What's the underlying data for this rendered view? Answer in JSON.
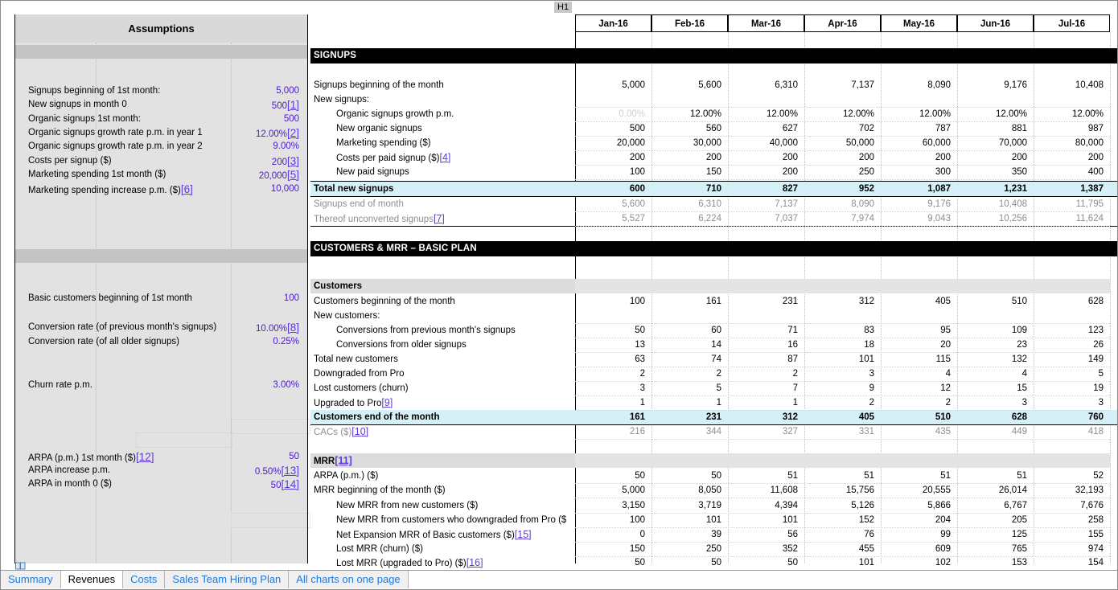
{
  "namebox": {
    "value": "H1"
  },
  "assumptions": {
    "title": "Assumptions",
    "rows": [
      {
        "label": "Signups beginning of 1st month:",
        "value": "5,000",
        "ref": ""
      },
      {
        "label": "New signups in month 0",
        "value": "500",
        "ref": "[1]"
      },
      {
        "label": "Organic signups 1st month:",
        "value": "500",
        "ref": ""
      },
      {
        "label": "Organic signups growth rate p.m. in year 1",
        "value": "12.00%",
        "ref": "[2]"
      },
      {
        "label": "Organic signups growth rate p.m. in year 2",
        "value": "9.00%",
        "ref": ""
      },
      {
        "label": "Costs per signup ($)",
        "value": "200",
        "ref": "[3]"
      },
      {
        "label": "Marketing spending 1st month ($)",
        "value": "20,000",
        "ref": "[5]"
      },
      {
        "label": "Marketing spending increase p.m. ($)",
        "label_ref": "[6]",
        "value": "10,000",
        "ref": ""
      },
      {
        "label": "Basic customers beginning of 1st month",
        "value": "100",
        "ref": ""
      },
      {
        "label": "Conversion rate (of previous month's signups)",
        "value": "10.00%",
        "ref": "[8]"
      },
      {
        "label": "Conversion rate (of all older signups)",
        "value": "0.25%",
        "ref": ""
      },
      {
        "label": "Churn rate p.m.",
        "value": "3.00%",
        "ref": ""
      },
      {
        "label": "ARPA (p.m.) 1st month ($)",
        "label_ref": "[12]",
        "value": "50",
        "ref": ""
      },
      {
        "label": "ARPA increase p.m.",
        "value": "0.50%",
        "ref": "[13]"
      },
      {
        "label": "ARPA in month 0 ($)",
        "value": "50",
        "ref": "[14]"
      }
    ]
  },
  "grid": {
    "columns": [
      "Jan-16",
      "Feb-16",
      "Mar-16",
      "Apr-16",
      "May-16",
      "Jun-16",
      "Jul-16"
    ],
    "sections": [
      {
        "title": "SIGNUPS"
      },
      {
        "title": "CUSTOMERS & MRR – BASIC PLAN"
      }
    ],
    "subheads": [
      "Customers",
      "MRR"
    ],
    "mrr_subhead_ref": "[11]",
    "rows": [
      {
        "label": "Signups beginning of the month",
        "values": [
          "5,000",
          "5,600",
          "6,310",
          "7,137",
          "8,090",
          "9,176",
          "10,408"
        ]
      },
      {
        "label": "New signups:",
        "values": [
          "",
          "",
          "",
          "",
          "",
          "",
          ""
        ]
      },
      {
        "label": "Organic signups growth p.m.",
        "values": [
          "0.00%",
          "12.00%",
          "12.00%",
          "12.00%",
          "12.00%",
          "12.00%",
          "12.00%"
        ]
      },
      {
        "label": "New organic signups",
        "values": [
          "500",
          "560",
          "627",
          "702",
          "787",
          "881",
          "987"
        ]
      },
      {
        "label": "Marketing spending ($)",
        "values": [
          "20,000",
          "30,000",
          "40,000",
          "50,000",
          "60,000",
          "70,000",
          "80,000"
        ]
      },
      {
        "label": "Costs per paid signup ($)",
        "ref": "[4]",
        "values": [
          "200",
          "200",
          "200",
          "200",
          "200",
          "200",
          "200"
        ]
      },
      {
        "label": "New paid signups",
        "values": [
          "100",
          "150",
          "200",
          "250",
          "300",
          "350",
          "400"
        ]
      },
      {
        "label": "Total new signups",
        "values": [
          "600",
          "710",
          "827",
          "952",
          "1,087",
          "1,231",
          "1,387"
        ]
      },
      {
        "label": "Signups end of month",
        "values": [
          "5,600",
          "6,310",
          "7,137",
          "8,090",
          "9,176",
          "10,408",
          "11,795"
        ]
      },
      {
        "label": "Thereof unconverted signups",
        "ref": "[7]",
        "values": [
          "5,527",
          "6,224",
          "7,037",
          "7,974",
          "9,043",
          "10,256",
          "11,624"
        ]
      },
      {
        "label": "Customers beginning of the month",
        "values": [
          "100",
          "161",
          "231",
          "312",
          "405",
          "510",
          "628"
        ]
      },
      {
        "label": "New customers:",
        "values": [
          "",
          "",
          "",
          "",
          "",
          "",
          ""
        ]
      },
      {
        "label": "Conversions from previous month's signups",
        "values": [
          "50",
          "60",
          "71",
          "83",
          "95",
          "109",
          "123"
        ]
      },
      {
        "label": "Conversions from older signups",
        "values": [
          "13",
          "14",
          "16",
          "18",
          "20",
          "23",
          "26"
        ]
      },
      {
        "label": "Total new customers",
        "values": [
          "63",
          "74",
          "87",
          "101",
          "115",
          "132",
          "149"
        ]
      },
      {
        "label": "Downgraded from Pro",
        "values": [
          "2",
          "2",
          "2",
          "3",
          "4",
          "4",
          "5"
        ]
      },
      {
        "label": "Lost customers (churn)",
        "values": [
          "3",
          "5",
          "7",
          "9",
          "12",
          "15",
          "19"
        ]
      },
      {
        "label": "Upgraded to Pro",
        "ref": "[9]",
        "values": [
          "1",
          "1",
          "1",
          "2",
          "2",
          "3",
          "3"
        ]
      },
      {
        "label": "Customers end of the month",
        "values": [
          "161",
          "231",
          "312",
          "405",
          "510",
          "628",
          "760"
        ]
      },
      {
        "label": "CACs ($)",
        "ref": "[10]",
        "values": [
          "216",
          "344",
          "327",
          "331",
          "435",
          "449",
          "418"
        ]
      },
      {
        "label": "ARPA (p.m.) ($)",
        "values": [
          "50",
          "50",
          "51",
          "51",
          "51",
          "51",
          "52"
        ]
      },
      {
        "label": "MRR beginning of the month  ($)",
        "values": [
          "5,000",
          "8,050",
          "11,608",
          "15,756",
          "20,555",
          "26,014",
          "32,193"
        ]
      },
      {
        "label": "New MRR from new customers ($)",
        "values": [
          "3,150",
          "3,719",
          "4,394",
          "5,126",
          "5,866",
          "6,767",
          "7,676"
        ]
      },
      {
        "label": "New MRR from customers who downgraded from Pro ($",
        "values": [
          "100",
          "101",
          "101",
          "152",
          "204",
          "205",
          "258"
        ]
      },
      {
        "label": "Net Expansion MRR of Basic customers ($)",
        "ref": "[15]",
        "values": [
          "0",
          "39",
          "56",
          "76",
          "99",
          "125",
          "155"
        ]
      },
      {
        "label": "Lost MRR (churn) ($)",
        "values": [
          "150",
          "250",
          "352",
          "455",
          "609",
          "765",
          "974"
        ]
      },
      {
        "label": "Lost MRR (upgraded to Pro) ($)",
        "ref": "[16]",
        "values": [
          "50",
          "50",
          "50",
          "101",
          "102",
          "153",
          "154"
        ]
      }
    ]
  },
  "tabs": [
    {
      "label": "Summary",
      "active": false
    },
    {
      "label": "Revenues",
      "active": true
    },
    {
      "label": "Costs",
      "active": false
    },
    {
      "label": "Sales Team Hiring Plan",
      "active": false
    },
    {
      "label": "All charts on one page",
      "active": false
    }
  ]
}
